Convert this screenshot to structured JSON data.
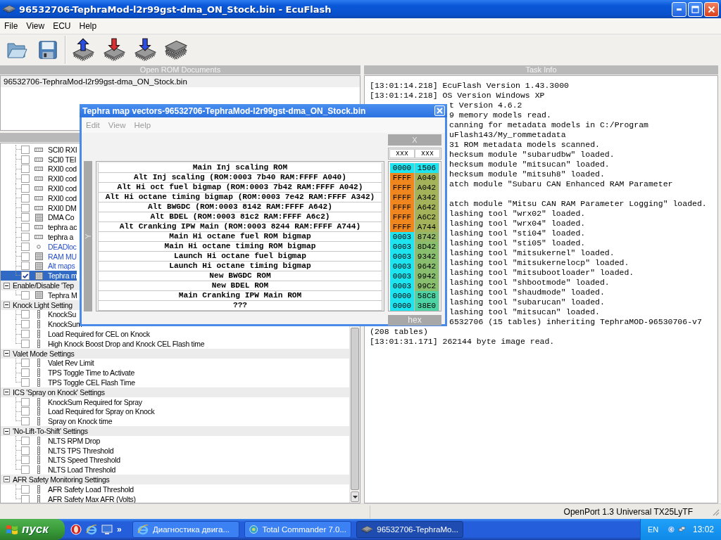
{
  "window": {
    "title": "96532706-TephraMod-l2r99gst-dma_ON_Stock.bin - EcuFlash"
  },
  "menu": [
    "File",
    "View",
    "ECU",
    "Help"
  ],
  "toolbar": {
    "file_buttons": [
      {
        "kind": "open"
      },
      {
        "kind": "save"
      }
    ],
    "ecu_buttons": [
      {
        "kind": "read"
      },
      {
        "kind": "write"
      },
      {
        "kind": "test"
      },
      {
        "kind": "chips"
      }
    ]
  },
  "rom_panel": {
    "header": "Open ROM Documents",
    "documents": [
      {
        "name": "96532706-TephraMod-l2r99gst-dma_ON_Stock.bin",
        "selected": true
      }
    ]
  },
  "tree": {
    "continued_items": [
      {
        "label": "SCI0 RXI",
        "kind": "strip",
        "checked": false,
        "selected": false,
        "emphasized": false
      },
      {
        "label": "SCI0 TEI",
        "kind": "strip",
        "checked": false,
        "selected": false,
        "emphasized": false
      },
      {
        "label": "RXI0 cod",
        "kind": "strip",
        "checked": false,
        "selected": false,
        "emphasized": false
      },
      {
        "label": "RXI0 cod",
        "kind": "strip",
        "checked": false,
        "selected": false,
        "emphasized": false
      },
      {
        "label": "RXI0 cod",
        "kind": "strip",
        "checked": false,
        "selected": false,
        "emphasized": false
      },
      {
        "label": "RXI0 cod",
        "kind": "strip",
        "checked": false,
        "selected": false,
        "emphasized": false
      },
      {
        "label": "RXI0 DM",
        "kind": "strip",
        "checked": false,
        "selected": false,
        "emphasized": false
      },
      {
        "label": "DMA Co",
        "kind": "grid",
        "checked": false,
        "selected": false,
        "emphasized": false
      },
      {
        "label": "tephra ac",
        "kind": "strip",
        "checked": false,
        "selected": false,
        "emphasized": false
      },
      {
        "label": "tephra a",
        "kind": "strip",
        "checked": false,
        "selected": false,
        "emphasized": false
      },
      {
        "label": "DEADloc",
        "kind": "switch",
        "checked": false,
        "selected": false,
        "emphasized": true
      },
      {
        "label": "RAM MU",
        "kind": "grid",
        "checked": false,
        "selected": false,
        "emphasized": true
      },
      {
        "label": "Alt maps",
        "kind": "grid",
        "checked": false,
        "selected": false,
        "emphasized": true
      },
      {
        "label": "Tephra m",
        "kind": "grid",
        "checked": true,
        "selected": true,
        "emphasized": false
      }
    ],
    "groups": [
      {
        "label": "Enable/Disable 'Tep",
        "expanded": true,
        "children": [
          {
            "label": "Tephra M",
            "kind": "grid",
            "checked": false,
            "selected": false
          }
        ]
      },
      {
        "label": "Knock Light Setting",
        "expanded": true,
        "children": [
          {
            "label": "KnockSu",
            "kind": "scalar",
            "checked": false,
            "selected": false
          },
          {
            "label": "KnockSum",
            "kind": "scalar",
            "checked": false,
            "selected": false
          },
          {
            "label": "Load Required for CEL on Knock",
            "kind": "scalar",
            "checked": false,
            "selected": false
          },
          {
            "label": "High Knock Boost Drop and Knock CEL Flash time",
            "kind": "scalar",
            "checked": false,
            "selected": false
          }
        ]
      },
      {
        "label": "Valet Mode Settings",
        "expanded": true,
        "children": [
          {
            "label": "Valet Rev Limit",
            "kind": "scalar",
            "checked": false,
            "selected": false
          },
          {
            "label": "TPS Toggle Time to Activate",
            "kind": "scalar",
            "checked": false,
            "selected": false
          },
          {
            "label": "TPS Toggle CEL Flash Time",
            "kind": "scalar",
            "checked": false,
            "selected": false
          }
        ]
      },
      {
        "label": "ICS 'Spray on Knock' Settings",
        "expanded": true,
        "children": [
          {
            "label": "KnockSum Required for Spray",
            "kind": "scalar",
            "checked": false,
            "selected": false
          },
          {
            "label": "Load Required for Spray on Knock",
            "kind": "scalar",
            "checked": false,
            "selected": false
          },
          {
            "label": "Spray on Knock time",
            "kind": "scalar",
            "checked": false,
            "selected": false
          }
        ]
      },
      {
        "label": "'No-Lift-To-Shift' Settings",
        "expanded": true,
        "children": [
          {
            "label": "NLTS RPM Drop",
            "kind": "scalar",
            "checked": false,
            "selected": false
          },
          {
            "label": "NLTS TPS Threshold",
            "kind": "scalar",
            "checked": false,
            "selected": false
          },
          {
            "label": "NLTS Speed Threshold",
            "kind": "scalar",
            "checked": false,
            "selected": false
          },
          {
            "label": "NLTS Load Threshold",
            "kind": "scalar",
            "checked": false,
            "selected": false
          }
        ]
      },
      {
        "label": "AFR Safety Monitoring Settings",
        "expanded": true,
        "children": [
          {
            "label": "AFR Safety Load Threshold",
            "kind": "scalar",
            "checked": false,
            "selected": false
          },
          {
            "label": "AFR Safety Max AFR (Volts)",
            "kind": "scalar",
            "checked": false,
            "selected": false
          }
        ]
      }
    ]
  },
  "task_panel": {
    "header": "Task Info",
    "log": [
      {
        "text": "[13:01:14.218] EcuFlash Version 1.43.3000",
        "kind": "full"
      },
      {
        "text": "[13:01:14.218] OS Version Windows XP",
        "kind": "full"
      },
      {
        "text": "t Version 4.6.2",
        "kind": "partial"
      },
      {
        "text": "9 memory models read.",
        "kind": "partial"
      },
      {
        "text": "canning for metadata models in C:/Program",
        "kind": "partial"
      },
      {
        "text": "uFlash143/My_rommetadata",
        "kind": "partial"
      },
      {
        "text": "31 ROM metadata models scanned.",
        "kind": "partial"
      },
      {
        "text": "hecksum module \"subarudbw\" loaded.",
        "kind": "partial"
      },
      {
        "text": "hecksum module \"mitsucan\" loaded.",
        "kind": "partial"
      },
      {
        "text": "hecksum module \"mitsuh8\" loaded.",
        "kind": "partial"
      },
      {
        "text": "atch module \"Subaru CAN Enhanced RAM Parameter",
        "kind": "partial_wrapped"
      },
      {
        "text": "atch module \"Mitsu CAN RAM Parameter Logging\" loaded.",
        "kind": "partial"
      },
      {
        "text": "lashing tool \"wrx02\" loaded.",
        "kind": "partial"
      },
      {
        "text": "lashing tool \"wrx04\" loaded.",
        "kind": "partial"
      },
      {
        "text": "lashing tool \"sti04\" loaded.",
        "kind": "partial"
      },
      {
        "text": "lashing tool \"sti05\" loaded.",
        "kind": "partial"
      },
      {
        "text": "lashing tool \"mitsukernel\" loaded.",
        "kind": "partial"
      },
      {
        "text": "lashing tool \"mitsukernelocp\" loaded.",
        "kind": "partial"
      },
      {
        "text": "lashing tool \"mitsubootloader\" loaded.",
        "kind": "partial"
      },
      {
        "text": "lashing tool \"shbootmode\" loaded.",
        "kind": "partial"
      },
      {
        "text": "lashing tool \"shaudmode\" loaded.",
        "kind": "partial"
      },
      {
        "text": "lashing tool \"subarucan\" loaded.",
        "kind": "partial"
      },
      {
        "text": "lashing tool \"mitsucan\" loaded.",
        "kind": "partial"
      },
      {
        "text": "6532706 (15 tables) inheriting TephraMOD-96530706-v7",
        "kind": "partial"
      },
      {
        "text": "(208 tables)",
        "kind": "full"
      },
      {
        "text": "[13:01:31.171] 262144 byte image read.",
        "kind": "full"
      }
    ]
  },
  "status_bar": {
    "port": "OpenPort 1.3 Universal TX25LyTF"
  },
  "dialog": {
    "title": "Tephra map vectors-96532706-TephraMod-l2r99gst-dma_ON_Stock.bin",
    "menu": [
      {
        "label": "Edit",
        "disabled": true
      },
      {
        "label": "View",
        "disabled": true
      },
      {
        "label": "Help",
        "disabled": true
      }
    ],
    "x_axis": {
      "label": "X",
      "cells": [
        "xxx",
        "xxx"
      ]
    },
    "y_axis": {
      "label": "Y"
    },
    "rows": [
      {
        "label": "Main Inj scaling ROM",
        "cells": [
          {
            "text": "0000",
            "color": "#1ee4f0"
          },
          {
            "text": "1506",
            "color": "#1ee4f0"
          }
        ]
      },
      {
        "label": "Alt Inj scaling (ROM:0003 7b40 RAM:FFFF A040)",
        "cells": [
          {
            "text": "FFFF",
            "color": "#f0861e"
          },
          {
            "text": "A040",
            "color": "#a4b25a"
          }
        ]
      },
      {
        "label": "Alt Hi oct fuel bigmap (ROM:0003 7b42 RAM:FFFF A042)",
        "cells": [
          {
            "text": "FFFF",
            "color": "#f0861e"
          },
          {
            "text": "A042",
            "color": "#a4b25a"
          }
        ]
      },
      {
        "label": "Alt Hi octane timing bigmap (ROM:0003 7e42 RAM:FFFF A342)",
        "cells": [
          {
            "text": "FFFF",
            "color": "#f0861e"
          },
          {
            "text": "A342",
            "color": "#a4b25a"
          }
        ]
      },
      {
        "label": "Alt BWGDC (ROM:0003 8142 RAM:FFFF A642)",
        "cells": [
          {
            "text": "FFFF",
            "color": "#f0861e"
          },
          {
            "text": "A642",
            "color": "#a4b25a"
          }
        ]
      },
      {
        "label": "Alt BDEL (ROM:0003 81c2 RAM:FFFF A6c2)",
        "cells": [
          {
            "text": "FFFF",
            "color": "#f0861e"
          },
          {
            "text": "A6C2",
            "color": "#a4b25a"
          }
        ]
      },
      {
        "label": "Alt Cranking IPW Main (ROM:0003 8244 RAM:FFFF A744)",
        "cells": [
          {
            "text": "FFFF",
            "color": "#f0861e"
          },
          {
            "text": "A744",
            "color": "#a4b25a"
          }
        ]
      },
      {
        "label": "Main Hi octane fuel ROM bigmap",
        "cells": [
          {
            "text": "0003",
            "color": "#1ee4f0"
          },
          {
            "text": "8742",
            "color": "#92b868"
          }
        ]
      },
      {
        "label": "Main Hi octane timing ROM bigmap",
        "cells": [
          {
            "text": "0003",
            "color": "#1ee4f0"
          },
          {
            "text": "8D42",
            "color": "#88be6e"
          }
        ]
      },
      {
        "label": "Launch Hi octane fuel bigmap",
        "cells": [
          {
            "text": "0003",
            "color": "#1ee4f0"
          },
          {
            "text": "9342",
            "color": "#88be6e"
          }
        ]
      },
      {
        "label": "Launch Hi octane timing bigmap",
        "cells": [
          {
            "text": "0003",
            "color": "#1ee4f0"
          },
          {
            "text": "9642",
            "color": "#88be6e"
          }
        ]
      },
      {
        "label": "New BWGDC ROM",
        "cells": [
          {
            "text": "0003",
            "color": "#1ee4f0"
          },
          {
            "text": "9942",
            "color": "#88be6e"
          }
        ]
      },
      {
        "label": "New BDEL ROM",
        "cells": [
          {
            "text": "0003",
            "color": "#1ee4f0"
          },
          {
            "text": "99C2",
            "color": "#88be6e"
          }
        ]
      },
      {
        "label": "Main Cranking IPW Main ROM",
        "cells": [
          {
            "text": "0000",
            "color": "#1ee4f0"
          },
          {
            "text": "58C8",
            "color": "#4ed4a4"
          }
        ]
      },
      {
        "label": "???",
        "cells": [
          {
            "text": "0000",
            "color": "#1ee4f0"
          },
          {
            "text": "38E0",
            "color": "#4ed4a4"
          }
        ]
      }
    ],
    "footer": "hex"
  },
  "taskbar": {
    "start": "пуск",
    "quick_launch_more": "»",
    "tasks": [
      {
        "label": "Диагностика двига...",
        "kind": "browser",
        "selected": false
      },
      {
        "label": "Total Commander 7.0...",
        "kind": "commander",
        "selected": false
      },
      {
        "label": "96532706-TephraMo...",
        "kind": "chip",
        "selected": true
      }
    ],
    "language": "EN",
    "clock": "13:02"
  }
}
